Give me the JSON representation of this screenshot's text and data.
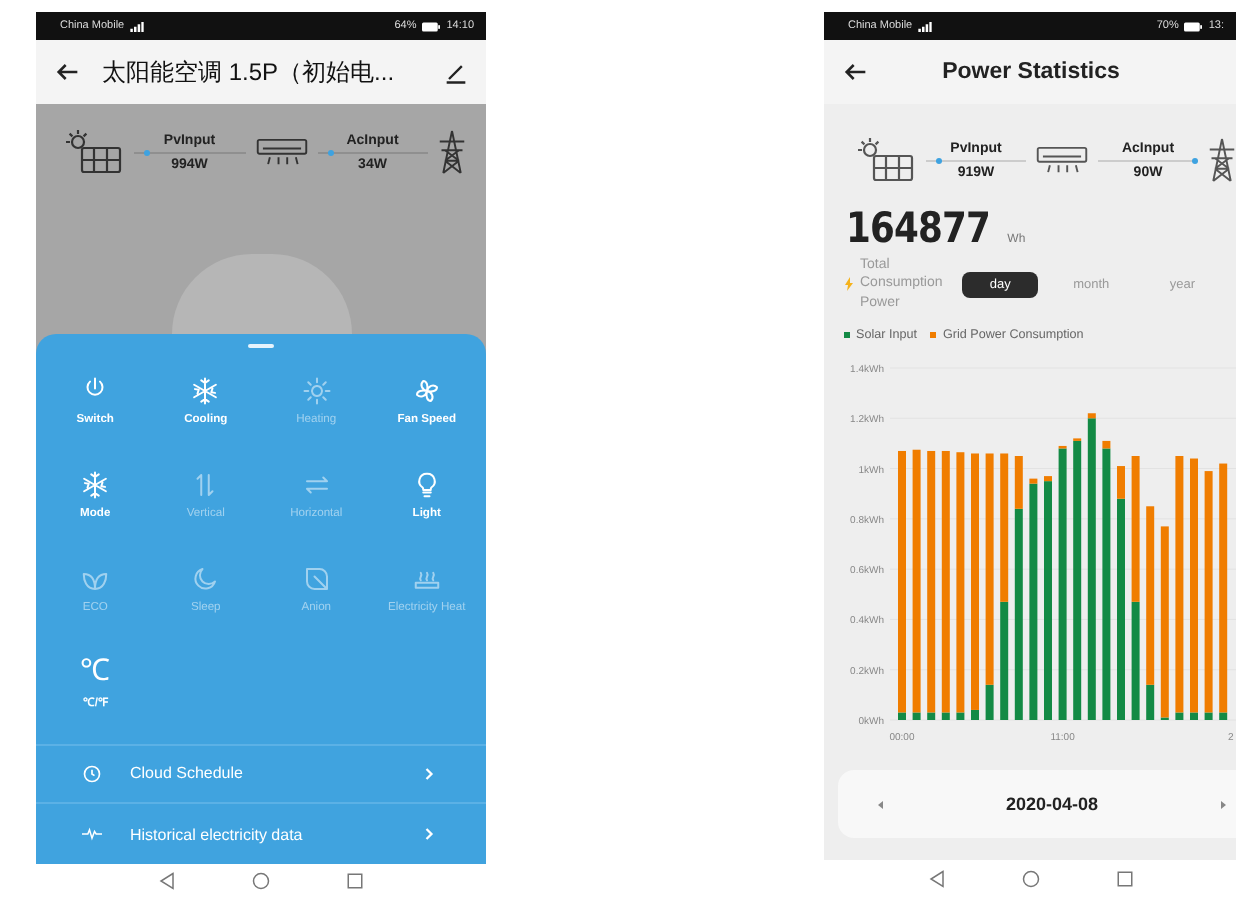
{
  "device_screen": {
    "status_bar": {
      "carrier": "China Mobile",
      "battery": "64%",
      "time": "14:10"
    },
    "title": "太阳能空调 1.5P（初始电...",
    "flow": {
      "pv_label": "PvInput",
      "pv_value": "994W",
      "ac_label": "AcInput",
      "ac_value": "34W"
    },
    "controls": [
      {
        "kind": "power",
        "label": "Switch",
        "on": true
      },
      {
        "kind": "snowflake",
        "label": "Cooling",
        "on": true
      },
      {
        "kind": "sun",
        "label": "Heating",
        "on": false
      },
      {
        "kind": "fan",
        "label": "Fan Speed",
        "on": true
      },
      {
        "kind": "snowflake",
        "label": "Mode",
        "on": true
      },
      {
        "kind": "vertical",
        "label": "Vertical",
        "on": false
      },
      {
        "kind": "horizontal",
        "label": "Horizontal",
        "on": false
      },
      {
        "kind": "bulb",
        "label": "Light",
        "on": true
      },
      {
        "kind": "leaves",
        "label": "ECO",
        "on": false
      },
      {
        "kind": "moon",
        "label": "Sleep",
        "on": false
      },
      {
        "kind": "leaf",
        "label": "Anion",
        "on": false
      },
      {
        "kind": "heater",
        "label": "Electricity Heat",
        "on": false
      },
      {
        "kind": "unit",
        "symbol": "℃",
        "label": "℃/℉",
        "on": true
      }
    ],
    "menu": [
      {
        "kind": "clock",
        "label": "Cloud Schedule"
      },
      {
        "kind": "pulse",
        "label": "Historical electricity data"
      }
    ]
  },
  "stats_screen": {
    "status_bar": {
      "carrier": "China Mobile",
      "battery": "70%",
      "time": "13:"
    },
    "title": "Power Statistics",
    "flow": {
      "pv_label": "PvInput",
      "pv_value": "919W",
      "ac_label": "AcInput",
      "ac_value": "90W"
    },
    "total": {
      "value": "164877",
      "unit": "Wh",
      "label": "Total Consumption Power"
    },
    "periods": [
      {
        "label": "day",
        "selected": true
      },
      {
        "label": "month",
        "selected": false
      },
      {
        "label": "year",
        "selected": false
      }
    ],
    "chart_data": {
      "type": "bar",
      "stacked": true,
      "x": [
        0,
        1,
        2,
        3,
        4,
        5,
        6,
        7,
        8,
        9,
        10,
        11,
        12,
        13,
        14,
        15,
        16,
        17,
        18,
        19,
        20,
        21,
        22
      ],
      "grid": true,
      "series": [
        {
          "name": "Solar Input",
          "color": "#138a45",
          "values": [
            0.03,
            0.03,
            0.03,
            0.03,
            0.03,
            0.04,
            0.14,
            0.47,
            0.84,
            0.94,
            0.95,
            1.08,
            1.11,
            1.2,
            1.08,
            0.88,
            0.47,
            0.14,
            0.01,
            0.03,
            0.03,
            0.03,
            0.03
          ]
        },
        {
          "name": "Grid Power Consumption",
          "color": "#f07d00",
          "values": [
            1.04,
            1.045,
            1.04,
            1.04,
            1.035,
            1.02,
            0.92,
            0.59,
            0.21,
            0.02,
            0.02,
            0.01,
            0.01,
            0.02,
            0.03,
            0.13,
            0.58,
            0.71,
            0.76,
            1.02,
            1.01,
            0.96,
            0.99
          ]
        }
      ],
      "ylim": [
        0,
        1.4
      ],
      "yticks": [
        {
          "value": 0,
          "label": "0kWh"
        },
        {
          "value": 0.2,
          "label": "0.2kWh"
        },
        {
          "value": 0.4,
          "label": "0.4kWh"
        },
        {
          "value": 0.6,
          "label": "0.6kWh"
        },
        {
          "value": 0.8,
          "label": "0.8kWh"
        },
        {
          "value": 1,
          "label": "1kWh"
        },
        {
          "value": 1.2,
          "label": "1.2kWh"
        },
        {
          "value": 1.4,
          "label": "1.4kWh"
        }
      ],
      "xlim": [
        0,
        22
      ],
      "xticks": [
        {
          "value": 0,
          "label": "00:00"
        },
        {
          "value": 11,
          "label": "11:00"
        }
      ]
    },
    "chart_edge_label": "2",
    "date": "2020-04-08"
  }
}
